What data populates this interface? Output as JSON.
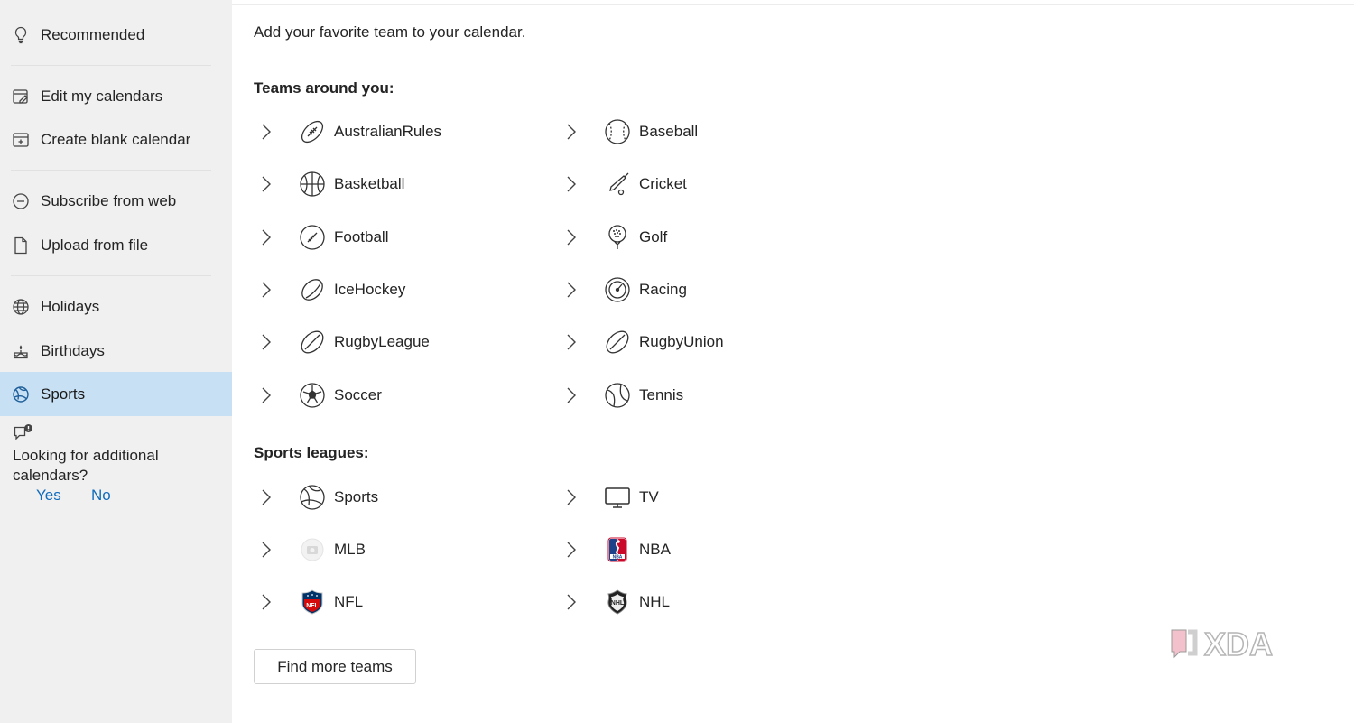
{
  "sidebar": {
    "items": [
      {
        "label": "Recommended",
        "icon": "lightbulb-icon"
      },
      {
        "label": "Edit my calendars",
        "icon": "edit-calendar-icon"
      },
      {
        "label": "Create blank calendar",
        "icon": "add-calendar-icon"
      },
      {
        "label": "Subscribe from web",
        "icon": "link-circle-icon"
      },
      {
        "label": "Upload from file",
        "icon": "document-icon"
      },
      {
        "label": "Holidays",
        "icon": "globe-icon"
      },
      {
        "label": "Birthdays",
        "icon": "cake-icon"
      },
      {
        "label": "Sports",
        "icon": "sports-icon",
        "selected": true
      }
    ],
    "feedback": {
      "question": "Looking for additional calendars?",
      "yes": "Yes",
      "no": "No"
    }
  },
  "main": {
    "intro": "Add your favorite team to your calendar.",
    "teams_title": "Teams around you:",
    "teams": [
      {
        "label": "AustralianRules",
        "icon": "australian-rules-ball-icon"
      },
      {
        "label": "Baseball",
        "icon": "baseball-icon"
      },
      {
        "label": "Basketball",
        "icon": "basketball-icon"
      },
      {
        "label": "Cricket",
        "icon": "cricket-bat-icon"
      },
      {
        "label": "Football",
        "icon": "football-icon"
      },
      {
        "label": "Golf",
        "icon": "golf-ball-icon"
      },
      {
        "label": "IceHockey",
        "icon": "hockey-puck-icon"
      },
      {
        "label": "Racing",
        "icon": "speedometer-icon"
      },
      {
        "label": "RugbyLeague",
        "icon": "rugby-ball-icon"
      },
      {
        "label": "RugbyUnion",
        "icon": "rugby-ball-icon"
      },
      {
        "label": "Soccer",
        "icon": "soccer-ball-icon"
      },
      {
        "label": "Tennis",
        "icon": "tennis-ball-icon"
      }
    ],
    "leagues_title": "Sports leagues:",
    "leagues": [
      {
        "label": "Sports",
        "icon": "sports-icon"
      },
      {
        "label": "TV",
        "icon": "tv-icon"
      },
      {
        "label": "MLB",
        "icon": "mlb-logo-icon"
      },
      {
        "label": "NBA",
        "icon": "nba-logo-icon"
      },
      {
        "label": "NFL",
        "icon": "nfl-logo-icon"
      },
      {
        "label": "NHL",
        "icon": "nhl-logo-icon"
      }
    ],
    "find_more_label": "Find more teams"
  },
  "watermark": "XDA",
  "colors": {
    "sidebar_bg": "#f0f0f0",
    "selected_bg": "#c7e0f4",
    "link": "#0f6cbd",
    "text": "#242424"
  }
}
